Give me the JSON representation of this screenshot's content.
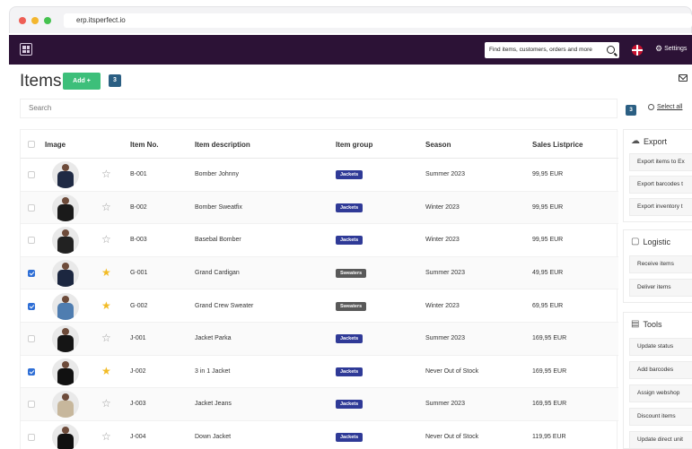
{
  "browser": {
    "url": "erp.itsperfect.io",
    "dot_colors": [
      "#ee5e55",
      "#f3b62e",
      "#45c24f"
    ]
  },
  "nav": {
    "search_placeholder": "Find items, customers, orders and more",
    "settings_label": "Settings",
    "bg_color": "#2c1236"
  },
  "header": {
    "title": "Items",
    "add_label": "Add +",
    "count": "3"
  },
  "search": {
    "placeholder": "Search",
    "selected_count": "3",
    "select_all_label": "Select all"
  },
  "table": {
    "columns": [
      "Image",
      "Item No.",
      "Item description",
      "Item group",
      "Season",
      "Sales Listprice"
    ],
    "rows": [
      {
        "checked": false,
        "starred": false,
        "no": "B-001",
        "desc": "Bomber Johnny",
        "group": "Jackets",
        "season": "Summer 2023",
        "price": "99,95 EUR"
      },
      {
        "checked": false,
        "starred": false,
        "no": "B-002",
        "desc": "Bomber Sweatfix",
        "group": "Jackets",
        "season": "Winter 2023",
        "price": "99,95 EUR"
      },
      {
        "checked": false,
        "starred": false,
        "no": "B-003",
        "desc": "Basebal Bomber",
        "group": "Jackets",
        "season": "Winter 2023",
        "price": "99,95 EUR"
      },
      {
        "checked": true,
        "starred": true,
        "no": "G-001",
        "desc": "Grand Cardigan",
        "group": "Sweaters",
        "season": "Summer 2023",
        "price": "49,95 EUR"
      },
      {
        "checked": true,
        "starred": true,
        "no": "G-002",
        "desc": "Grand Crew Sweater",
        "group": "Sweaters",
        "season": "Winter 2023",
        "price": "69,95 EUR"
      },
      {
        "checked": false,
        "starred": false,
        "no": "J-001",
        "desc": "Jacket Parka",
        "group": "Jackets",
        "season": "Summer 2023",
        "price": "169,95 EUR"
      },
      {
        "checked": true,
        "starred": true,
        "no": "J-002",
        "desc": "3 in 1 Jacket",
        "group": "Jackets",
        "season": "Never Out of Stock",
        "price": "169,95 EUR"
      },
      {
        "checked": false,
        "starred": false,
        "no": "J-003",
        "desc": "Jacket Jeans",
        "group": "Jackets",
        "season": "Summer 2023",
        "price": "169,95 EUR"
      },
      {
        "checked": false,
        "starred": false,
        "no": "J-004",
        "desc": "Down Jacket",
        "group": "Jackets",
        "season": "Never Out of Stock",
        "price": "119,95 EUR"
      }
    ]
  },
  "panel": {
    "export": {
      "title": "Export",
      "items": [
        "Export items to Ex",
        "Export barcodes t",
        "Export inventory t"
      ]
    },
    "logistic": {
      "title": "Logistic",
      "items": [
        "Receive items",
        "Deliver items"
      ]
    },
    "tools": {
      "title": "Tools",
      "items": [
        "Update status",
        "Add barcodes",
        "Assign webshop",
        "Discount items",
        "Update direct unit"
      ]
    }
  },
  "colors": {
    "add_button": "#3dbf7a",
    "badge": "#2b5f83",
    "jackets_tag": "#2f3a97",
    "sweaters_tag": "#595959",
    "checkbox_on": "#2f6fd6",
    "star_on": "#f2bb25"
  }
}
